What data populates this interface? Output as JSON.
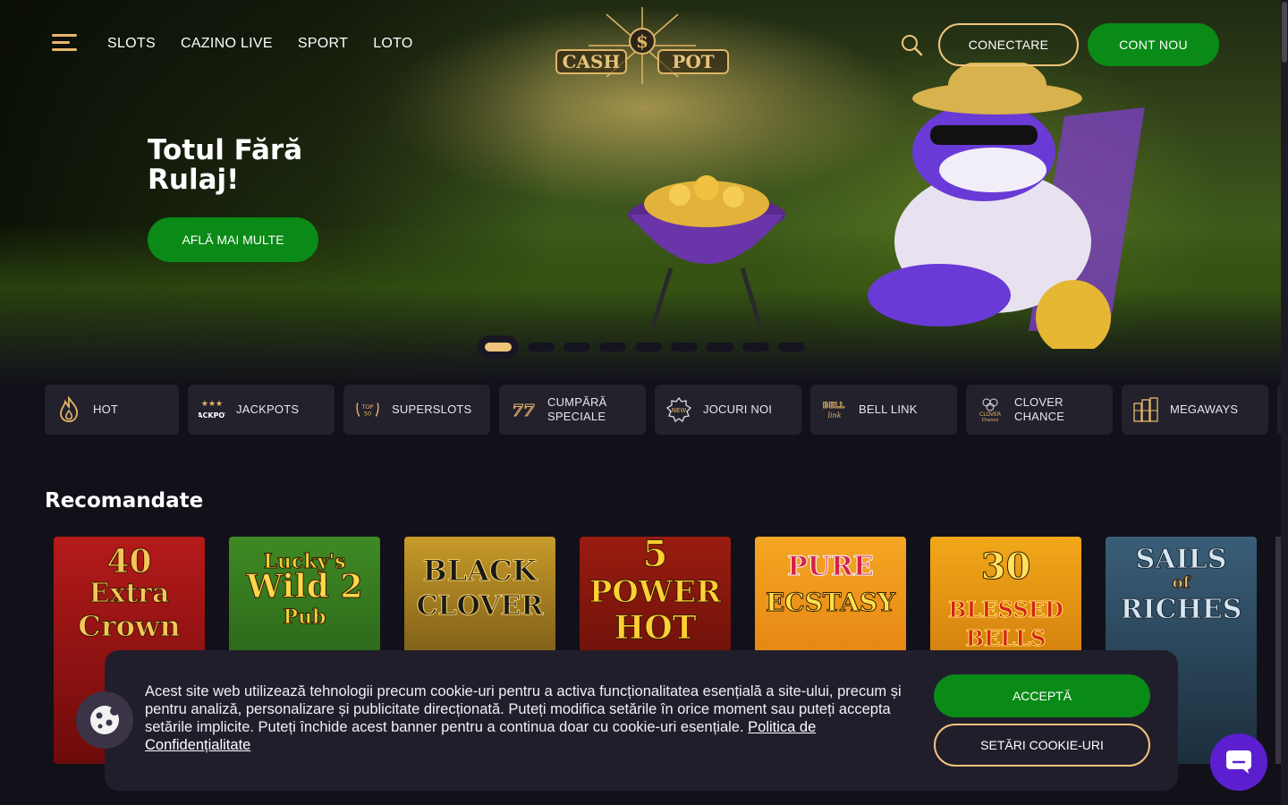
{
  "nav": {
    "menu_icon": "hamburger-icon",
    "items": [
      "SLOTS",
      "CAZINO LIVE",
      "SPORT",
      "LOTO"
    ],
    "logo_text": "CASH POT",
    "login_label": "CONECTARE",
    "register_label": "CONT NOU"
  },
  "hero": {
    "title": "Totul Fără Rulaj!",
    "cta_label": "AFLĂ MAI MULTE",
    "slides_count": 9,
    "active_slide": 1
  },
  "categories": [
    {
      "label": "HOT",
      "icon": "flame-icon"
    },
    {
      "label": "JACKPOTS",
      "icon": "jackpot-icon"
    },
    {
      "label": "SUPERSLOTS",
      "icon": "top50-icon"
    },
    {
      "label": "CUMPĂRĂ SPECIALE",
      "icon": "seven-icon"
    },
    {
      "label": "JOCURI NOI",
      "icon": "new-badge-icon"
    },
    {
      "label": "BELL LINK",
      "icon": "bell-link-icon"
    },
    {
      "label": "CLOVER CHANCE",
      "icon": "clover-icon"
    },
    {
      "label": "MEGAWAYS",
      "icon": "megaways-icon"
    }
  ],
  "section_title": "Recomandate",
  "games": [
    {
      "line1": "40",
      "line2": "Extra",
      "line3": "Crown"
    },
    {
      "line1": "Lucky's",
      "line2": "Wild 2",
      "line3": "Pub"
    },
    {
      "line1": "BLACK",
      "line2": "CLOVER",
      "line3": ""
    },
    {
      "line1": "5",
      "line2": "POWER",
      "line3": "HOT"
    },
    {
      "line1": "PURE",
      "line2": "ECSTASY",
      "line3": ""
    },
    {
      "line1": "30",
      "line2": "BLESSED",
      "line3": "BELLS"
    },
    {
      "line1": "SAILS",
      "line2": "of",
      "line3": "RICHES"
    }
  ],
  "cookie": {
    "text": "Acest site web utilizează tehnologii precum cookie-uri pentru a activa funcționalitatea esențială a site-ului, precum și pentru analiză, personalizare și publicitate direcționată. Puteți modifica setările în orice moment sau puteți accepta setările implicite. Puteți închide acest banner pentru a continua doar cu cookie-uri esențiale.",
    "link_label": "Politica de Confidențialitate",
    "accept_label": "ACCEPTĂ",
    "settings_label": "SETĂRI COOKIE-URI"
  },
  "colors": {
    "accent_gold": "#f1c47b",
    "primary_green": "#0a8a16",
    "chat_purple": "#5b1fd0",
    "background": "#12111a"
  }
}
